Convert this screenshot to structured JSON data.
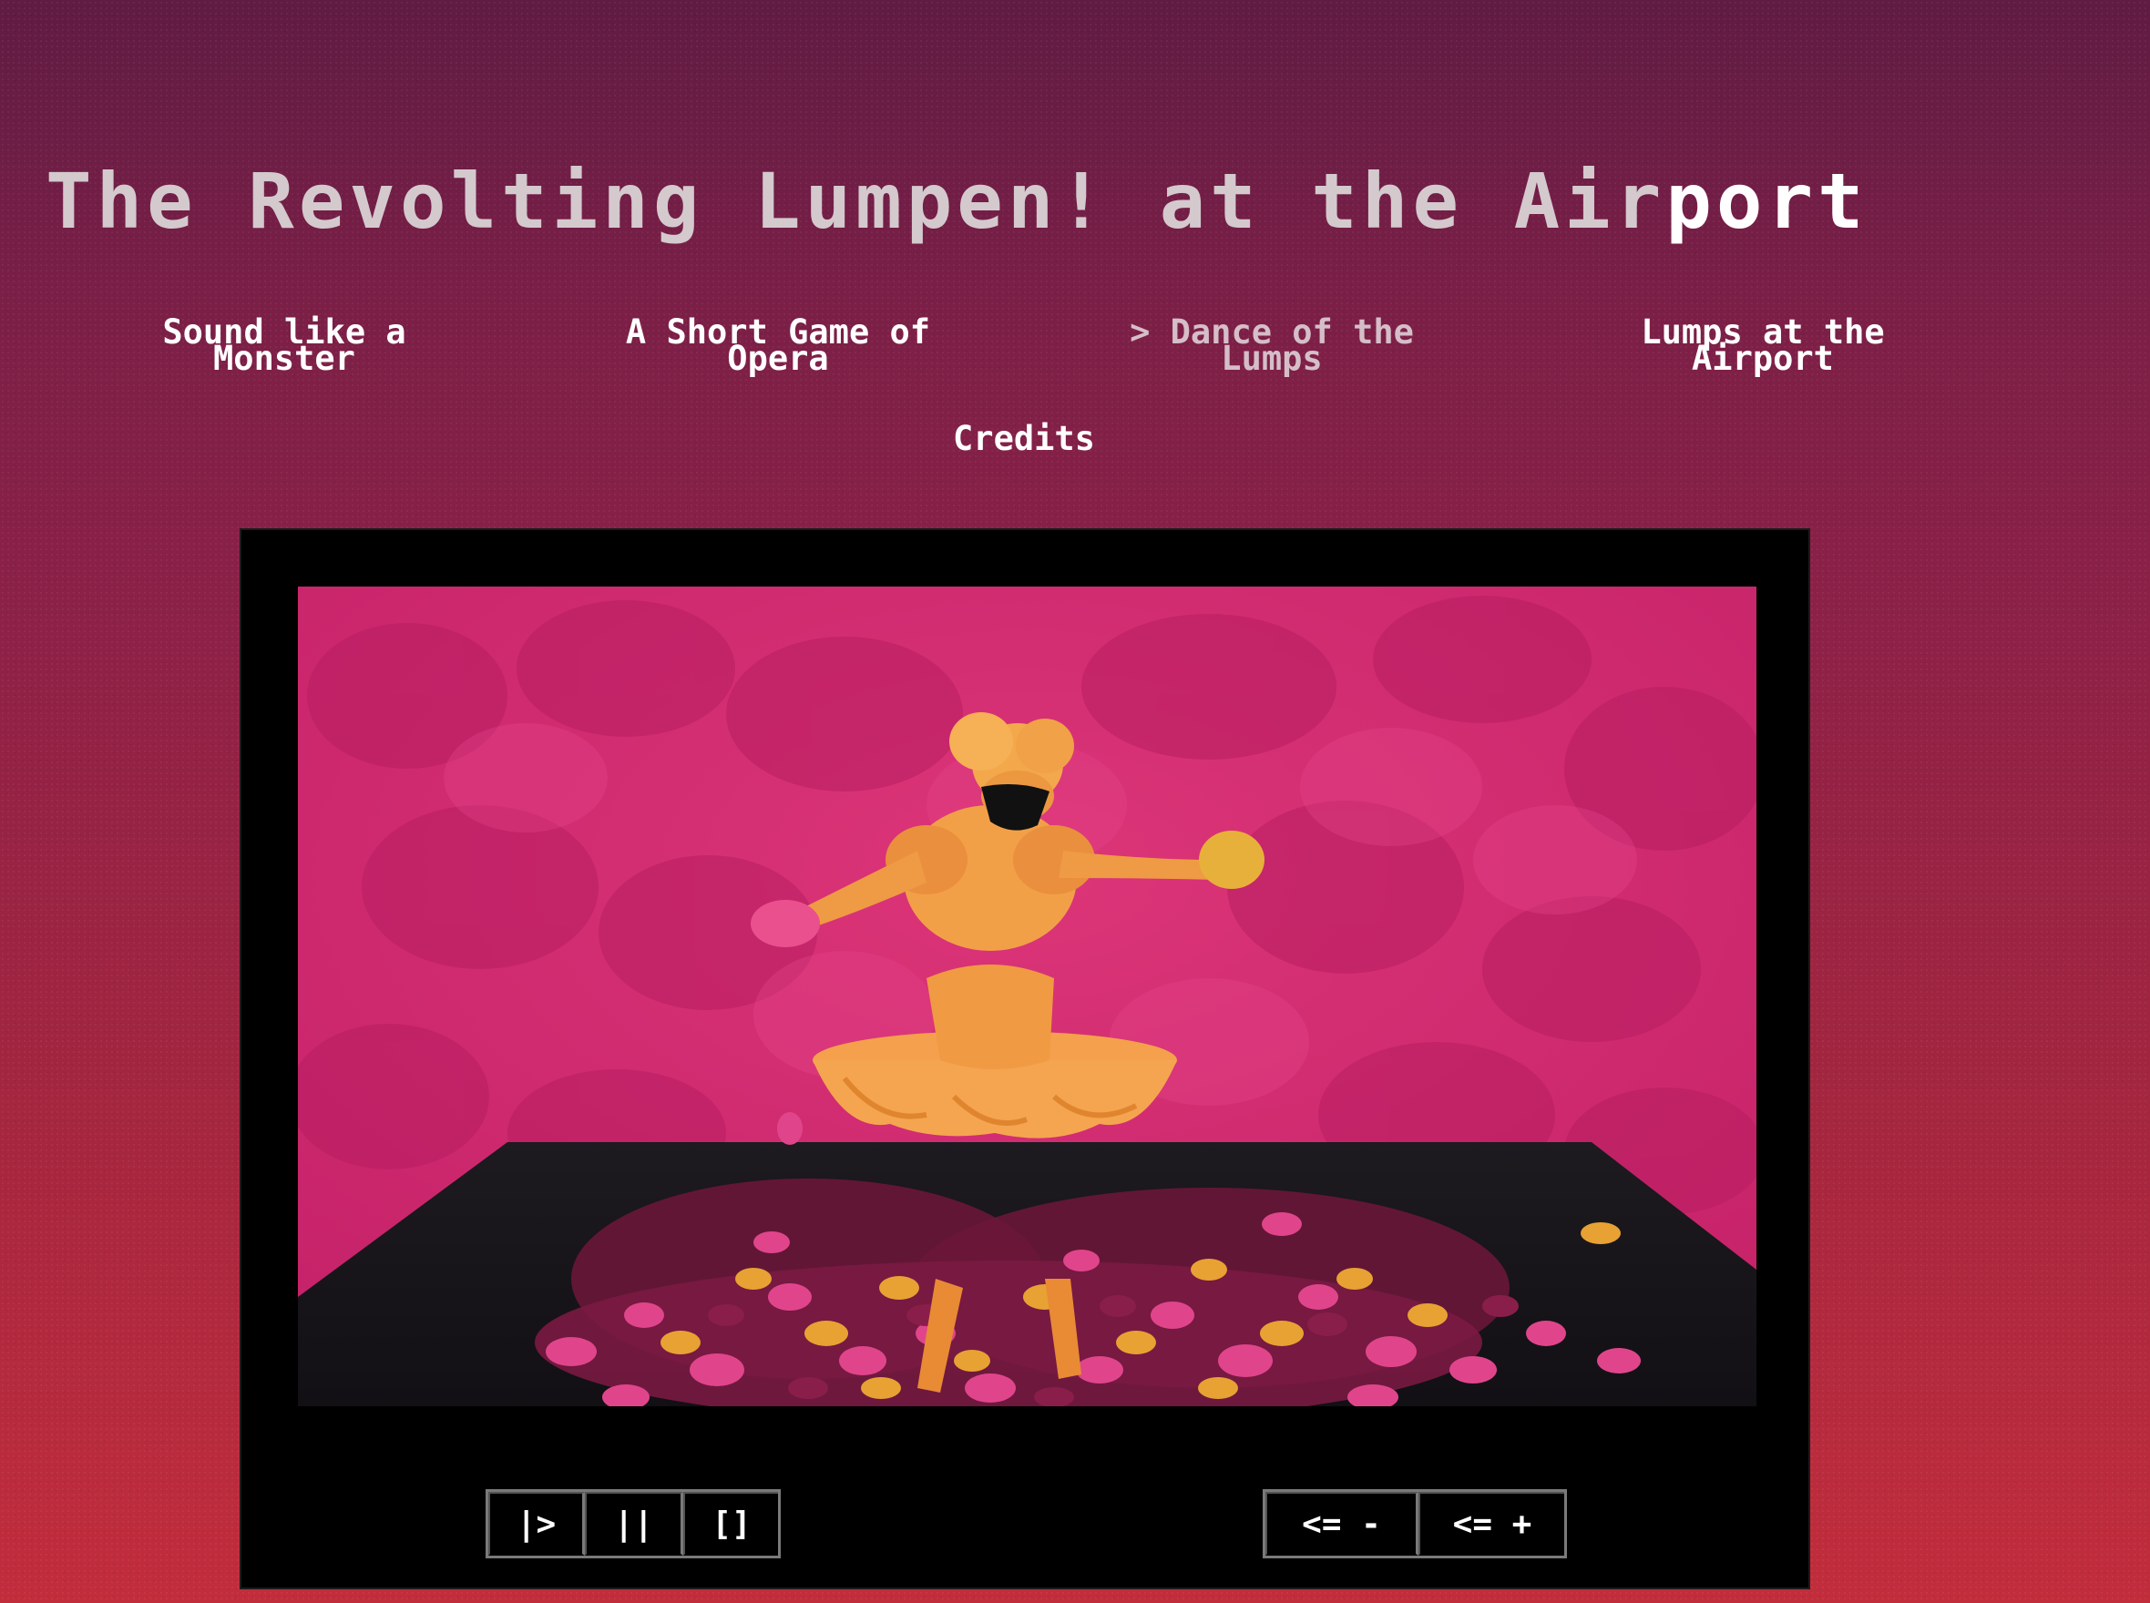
{
  "title": {
    "main": "The Revolting Lumpen! at the Air",
    "highlight": "port"
  },
  "nav": {
    "items": [
      {
        "line1": "Sound like a",
        "line2": "Monster",
        "active": false
      },
      {
        "line1": "A Short Game of",
        "line2": "Opera",
        "active": false
      },
      {
        "line1": "> Dance of the",
        "line2": "Lumps",
        "active": true
      },
      {
        "line1": "Lumps at the",
        "line2": "Airport",
        "active": false
      }
    ],
    "credits": "Credits"
  },
  "player": {
    "play_label": "|>",
    "pause_label": "||",
    "fullscreen_label": "[]",
    "slower_label": "<= -",
    "faster_label": "<= +"
  },
  "colors": {
    "accent_active": "#d5bec8",
    "title_text": "#d4c9cd",
    "background_top": "#601c43",
    "background_bottom": "#c22d3c"
  },
  "icons": {
    "play": "play-icon",
    "pause": "pause-icon",
    "fullscreen": "fullscreen-icon"
  }
}
